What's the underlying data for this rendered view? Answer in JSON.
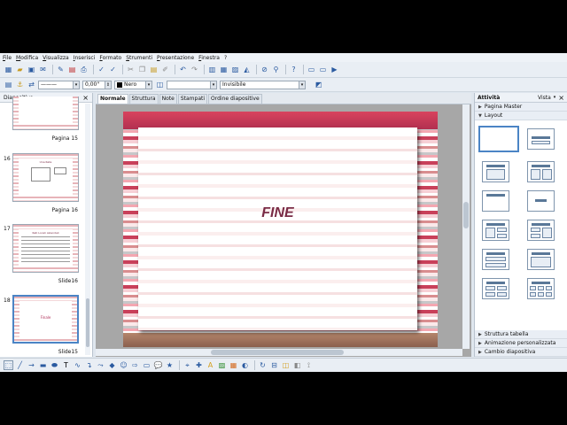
{
  "menu": [
    "File",
    "Modifica",
    "Visualizza",
    "Inserisci",
    "Formato",
    "Strumenti",
    "Presentazione",
    "Finestra",
    "?"
  ],
  "line_tools": {
    "width_value": "0,00\"",
    "color_value": "Nero",
    "area_value": "Invisibile"
  },
  "slides_pane": {
    "title": "Diapositive",
    "close": "×",
    "items": [
      {
        "number": "",
        "label": "Pagina 15"
      },
      {
        "number": "16",
        "label": "Pagina 16",
        "heading": "Una Rete"
      },
      {
        "number": "17",
        "label": "Slide16",
        "heading": "Reti Locali Aziendali"
      },
      {
        "number": "18",
        "label": "Slide15",
        "heading": "Finale",
        "selected": true
      }
    ]
  },
  "view_tabs": [
    "Normale",
    "Struttura",
    "Note",
    "Stampati",
    "Ordine diapositive"
  ],
  "slide": {
    "text": "FINE"
  },
  "tasks_pane": {
    "title": "Attività",
    "view_label": "Vista",
    "close": "×",
    "sections_top": [
      {
        "label": "Pagina Master",
        "expanded": false
      },
      {
        "label": "Layout",
        "expanded": true
      }
    ],
    "sections_bottom": [
      {
        "label": "Struttura tabella"
      },
      {
        "label": "Animazione personalizzata"
      },
      {
        "label": "Cambio diapositiva"
      }
    ]
  },
  "colors": {
    "accent": "#4b84c5",
    "slide_title_color": "#7a2c46",
    "stripe_red": "#c9405a"
  }
}
